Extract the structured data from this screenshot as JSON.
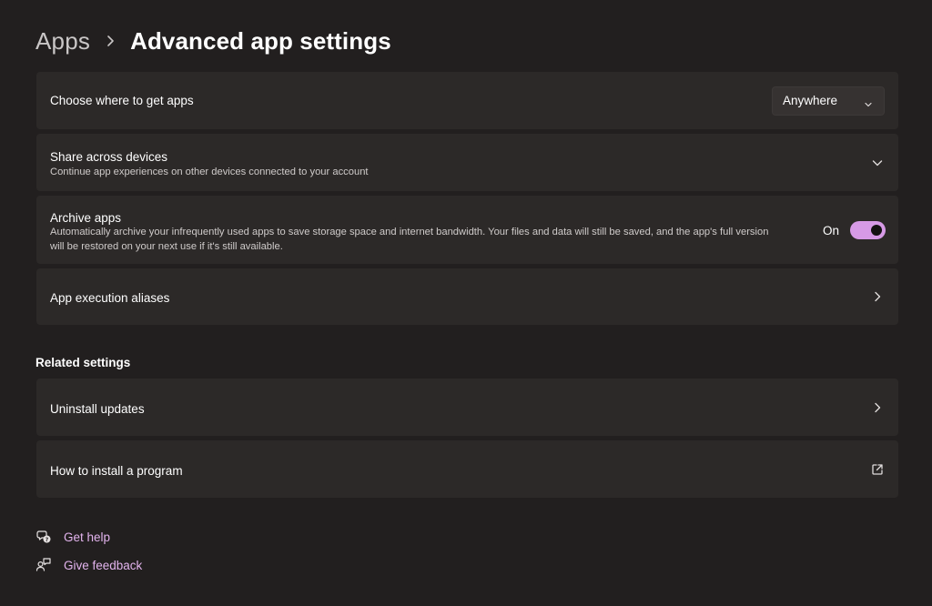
{
  "breadcrumb": {
    "parent": "Apps",
    "current": "Advanced app settings"
  },
  "settings": {
    "choose_where": {
      "title": "Choose where to get apps",
      "dropdown_value": "Anywhere"
    },
    "share_devices": {
      "title": "Share across devices",
      "description": "Continue app experiences on other devices connected to your account"
    },
    "archive_apps": {
      "title": "Archive apps",
      "description_line1": "Automatically archive your infrequently used apps to save storage space and internet bandwidth. Your files and data will still be saved, and the app's full version",
      "description_line2": "will be restored on your next use if it's still available.",
      "toggle_label": "On",
      "toggle_on": true
    },
    "execution_aliases": {
      "title": "App execution aliases"
    }
  },
  "related": {
    "heading": "Related settings",
    "uninstall_updates": "Uninstall updates",
    "how_to_install": "How to install a program"
  },
  "help_links": {
    "get_help": "Get help",
    "give_feedback": "Give feedback"
  },
  "colors": {
    "background": "#221f1f",
    "card": "#2c2928",
    "accent": "#d79ae6",
    "link": "#e3b4ee"
  },
  "icons": {
    "breadcrumb_sep": "chevron-right-icon",
    "dropdown": "chevron-down-icon",
    "expand": "chevron-down-icon",
    "navigate": "chevron-right-icon",
    "external": "open-external-icon",
    "help": "help-chat-icon",
    "feedback": "feedback-person-icon"
  }
}
